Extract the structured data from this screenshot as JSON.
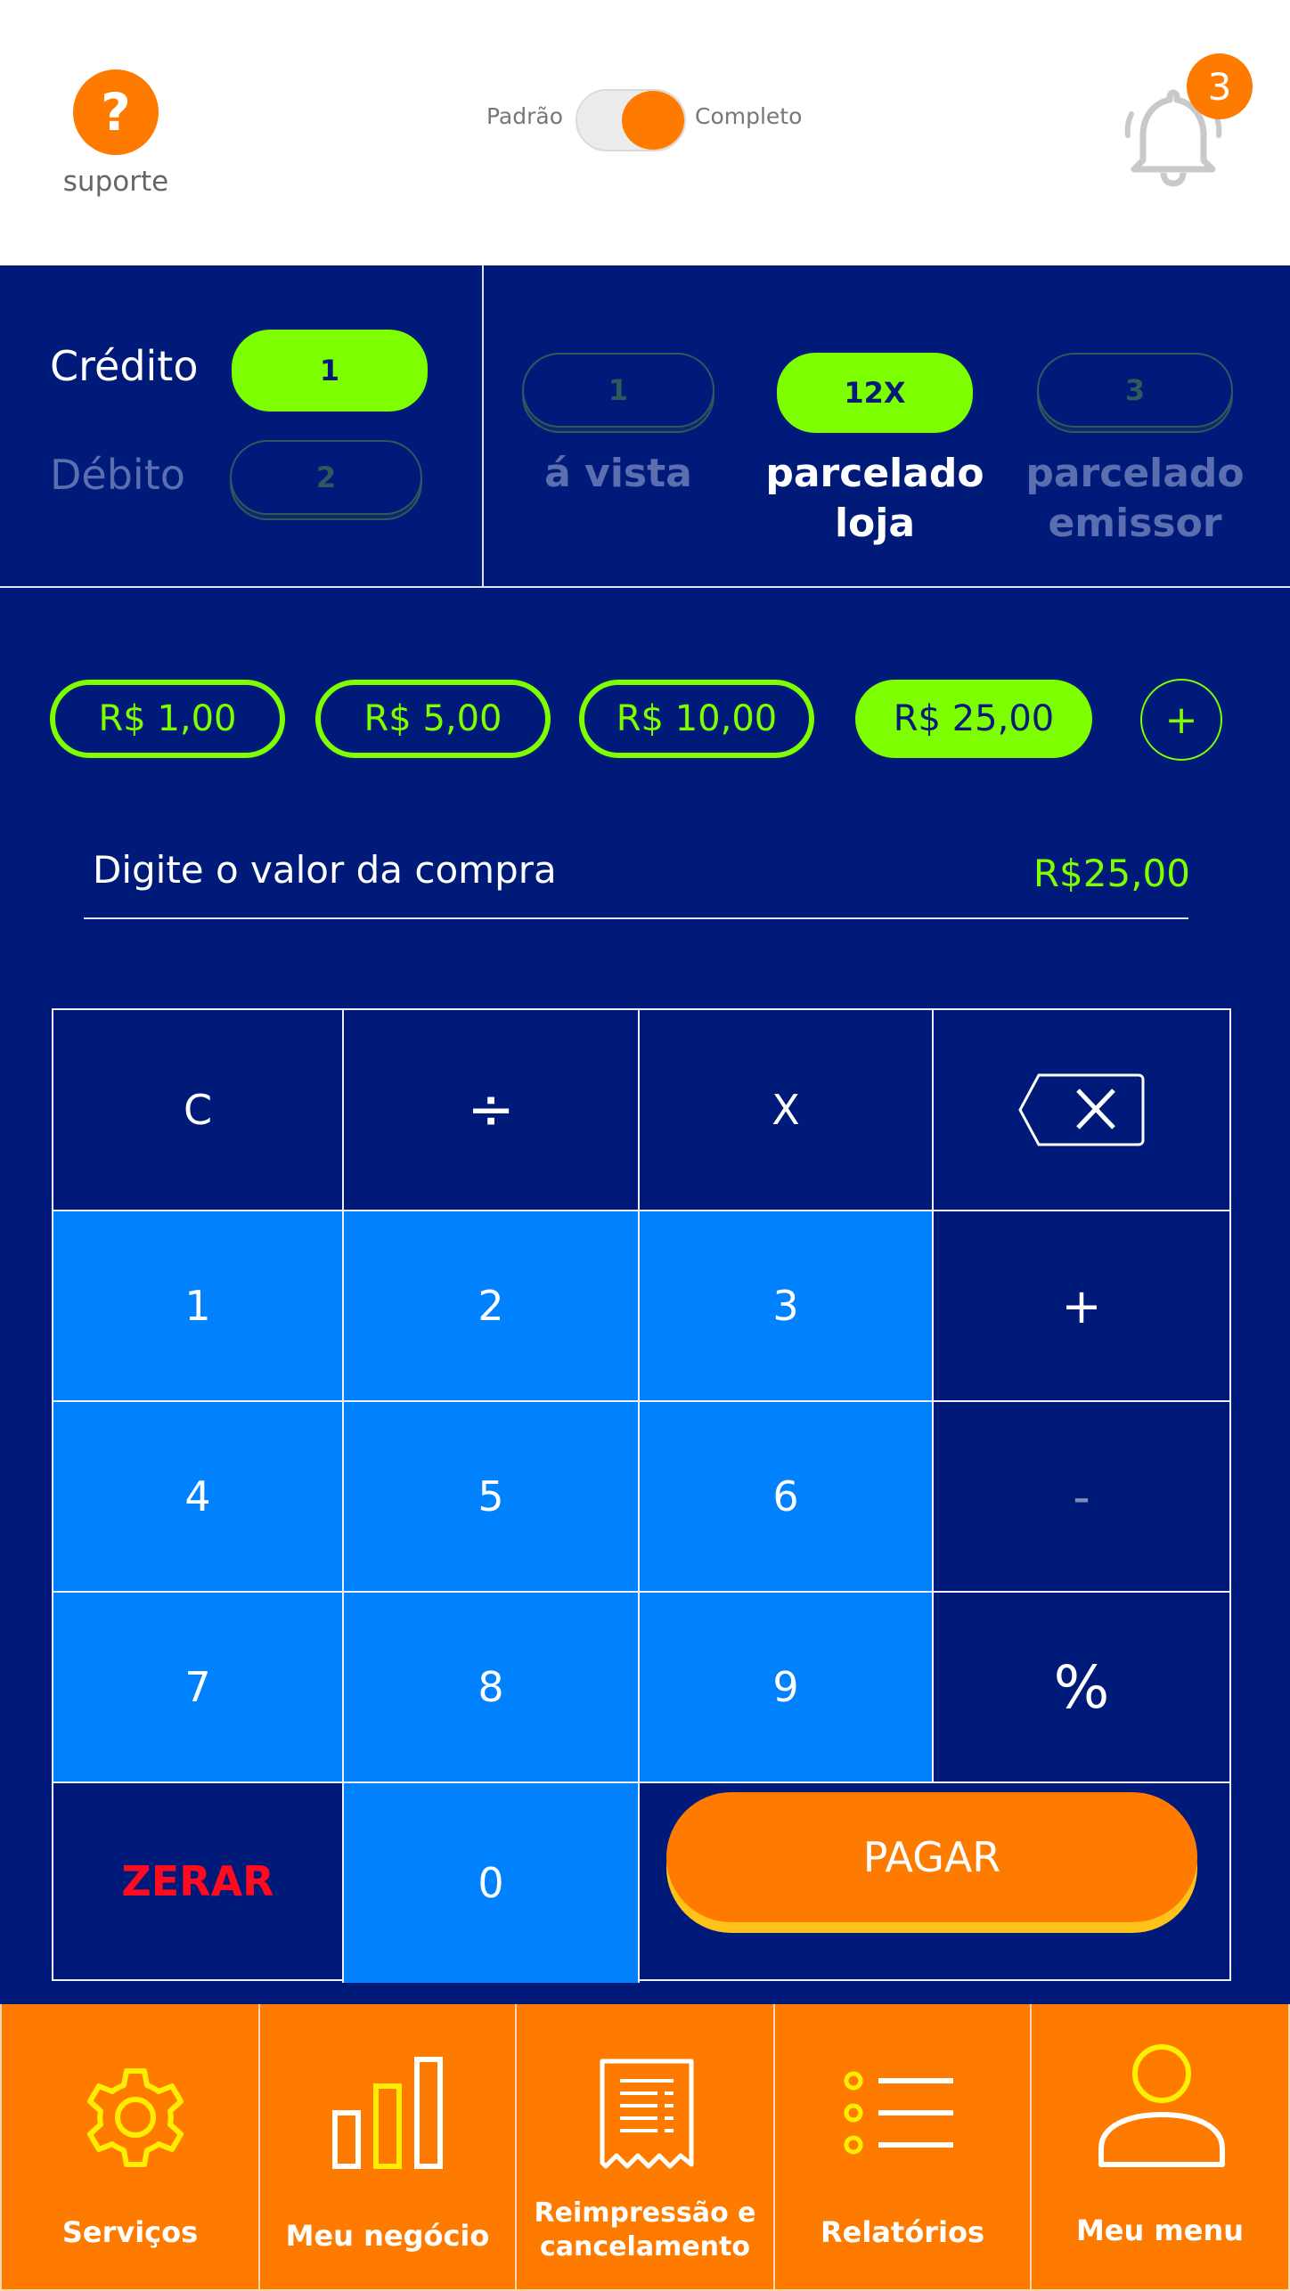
{
  "header": {
    "support_icon": "?",
    "support_label": "suporte",
    "toggle_left": "Padrão",
    "toggle_right": "Completo",
    "toggle_state": "Completo",
    "notification_count": "3"
  },
  "payment_type": {
    "credit_label": "Crédito",
    "credit_key": "1",
    "debit_label": "Débito",
    "debit_key": "2",
    "selected": "Crédito"
  },
  "installments": {
    "selected": "parcelado loja",
    "options": [
      {
        "key": "1",
        "label": "á vista"
      },
      {
        "key": "12X",
        "label_line1": "parcelado",
        "label_line2": "loja"
      },
      {
        "key": "3",
        "label_line1": "parcelado",
        "label_line2": "emissor"
      }
    ]
  },
  "quick_amounts": {
    "items": [
      "R$ 1,00",
      "R$ 5,00",
      "R$ 10,00",
      "R$ 25,00"
    ],
    "selected": "R$ 25,00",
    "add": "+"
  },
  "amount": {
    "label": "Digite o valor da compra",
    "value": "R$25,00"
  },
  "keypad": {
    "clear": "C",
    "divide": "÷",
    "multiply": "X",
    "k1": "1",
    "k2": "2",
    "k3": "3",
    "plus": "+",
    "k4": "4",
    "k5": "5",
    "k6": "6",
    "minus": "-",
    "k7": "7",
    "k8": "8",
    "k9": "9",
    "percent": "%",
    "zerar": "ZERAR",
    "k0": "0",
    "pay": "PAGAR"
  },
  "nav": {
    "items": [
      {
        "label": "Serviços",
        "icon": "gear-icon"
      },
      {
        "label": "Meu negócio",
        "icon": "bar-chart-icon"
      },
      {
        "label_line1": "Reimpressão e",
        "label_line2": "cancelamento",
        "icon": "receipt-icon"
      },
      {
        "label": "Relatórios",
        "icon": "list-icon"
      },
      {
        "label": "Meu menu",
        "icon": "user-icon"
      }
    ]
  },
  "colors": {
    "primary_blue": "#001a7a",
    "key_blue": "#0082ff",
    "accent_green": "#7dff00",
    "accent_orange": "#ff7b00",
    "danger_red": "#ff0a1e",
    "icon_yellow": "#ffee00"
  }
}
